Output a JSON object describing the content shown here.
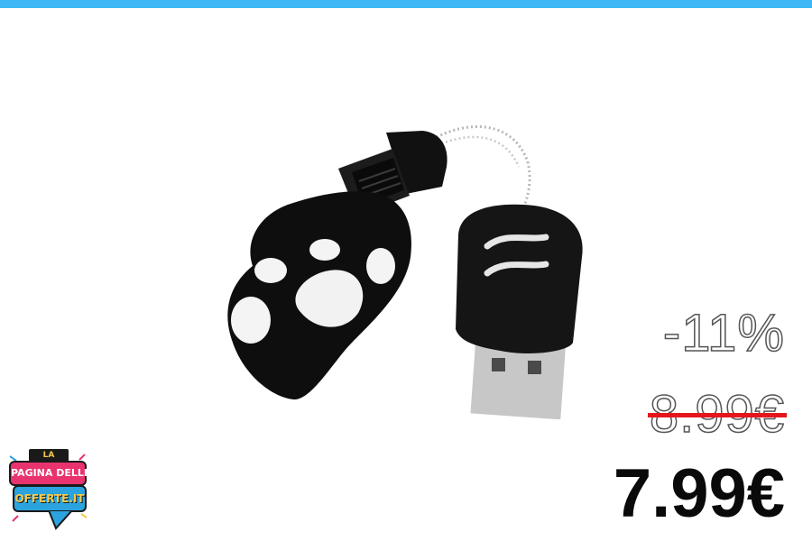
{
  "colors": {
    "top_bar": "#3db8f5",
    "strike": "#e5161b",
    "new_price": "#0a0a0a",
    "logo_pink": "#e8336f",
    "logo_blue": "#2aa3df",
    "logo_yellow": "#f6c94a"
  },
  "offer": {
    "discount": "-11%",
    "old_price": "8.99€",
    "new_price": "7.99€"
  },
  "logo": {
    "line1": "LA",
    "line2": "PAGINA DELLE",
    "line3": "OFFERTE.IT"
  },
  "product_image": {
    "icon": "usb-paw-flash-drive"
  }
}
